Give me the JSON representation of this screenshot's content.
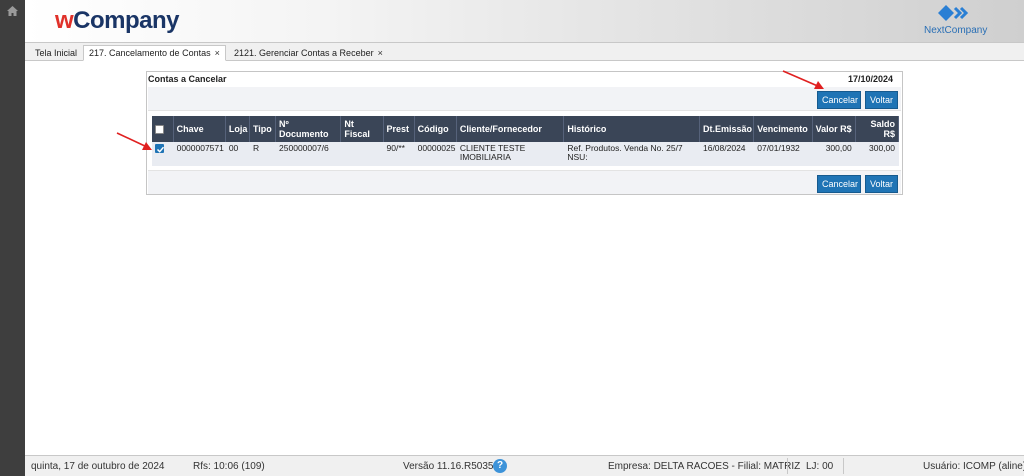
{
  "header": {
    "logo_w": "w",
    "logo_company": "Company",
    "brand_right": "NextCompany"
  },
  "tabs": [
    {
      "label": "Tela Inicial"
    },
    {
      "label": "217. Cancelamento de Contas",
      "close": "×"
    },
    {
      "label": "2121. Gerenciar Contas a Receber",
      "close": "×"
    }
  ],
  "panel": {
    "title": "Contas a Cancelar",
    "date": "17/10/2024",
    "cancel_label": "Cancelar",
    "back_label": "Voltar"
  },
  "table": {
    "headers": {
      "chave": "Chave",
      "loja": "Loja",
      "tipo": "Tipo",
      "documento": "Nº Documento",
      "nf_fiscal": "Nt Fiscal",
      "prest": "Prest",
      "codigo": "Código",
      "cliente": "Cliente/Fornecedor",
      "historico": "Histórico",
      "dt_emissao": "Dt.Emissão",
      "vencimento": "Vencimento",
      "valor": "Valor R$",
      "saldo": "Saldo R$"
    },
    "rows": [
      {
        "checked": true,
        "chave": "0000007571",
        "loja": "00",
        "tipo": "R",
        "documento": "250000007/6",
        "nf_fiscal": "",
        "prest": "90/**",
        "codigo": "00000025",
        "cliente": "CLIENTE TESTE IMOBILIARIA",
        "historico": "Ref. Produtos. Venda No. 25/7 NSU:",
        "dt_emissao": "16/08/2024",
        "vencimento": "07/01/1932",
        "valor": "300,00",
        "saldo": "300,00"
      }
    ]
  },
  "status": {
    "date_text": "quinta, 17 de outubro de 2024",
    "rfs": "Rfs: 10:06 (109)",
    "version": "Versão 11.16.R5035",
    "help": "?",
    "empresa": "Empresa: DELTA RACOES - Filial: MATRIZ",
    "loja": "LJ: 00",
    "usuario": "Usuário: ICOMP (aline)"
  },
  "colors": {
    "accent": "#1f74b5",
    "header_grid": "#3a4557",
    "arrow": "#e02020"
  }
}
